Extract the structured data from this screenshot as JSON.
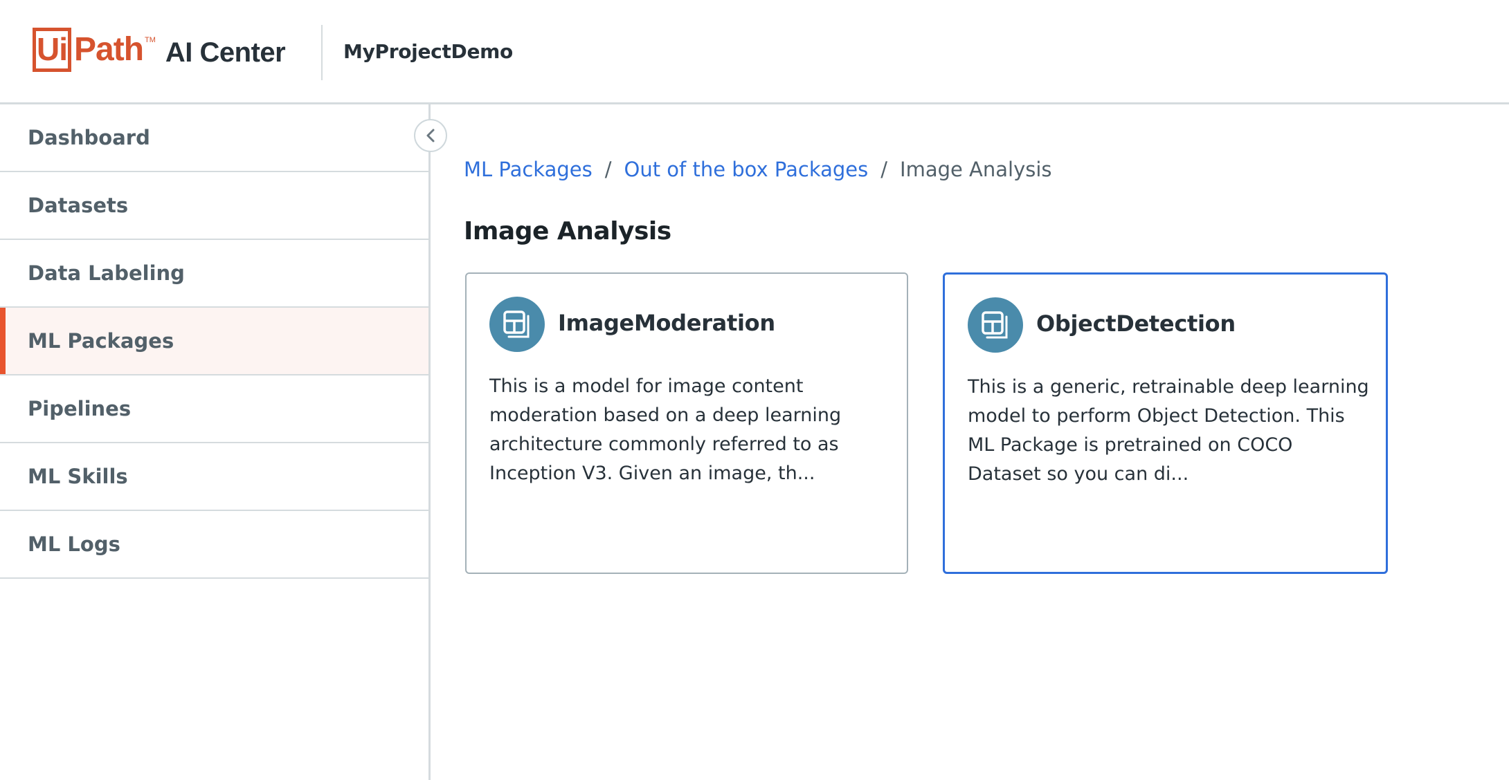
{
  "header": {
    "logo_brand": "Ui",
    "logo_brand_rest": "Path",
    "logo_tm": "TM",
    "product_name": "AI Center",
    "project_name": "MyProjectDemo"
  },
  "sidebar": {
    "items": [
      {
        "label": "Dashboard",
        "active": false
      },
      {
        "label": "Datasets",
        "active": false
      },
      {
        "label": "Data Labeling",
        "active": false
      },
      {
        "label": "ML Packages",
        "active": true
      },
      {
        "label": "Pipelines",
        "active": false
      },
      {
        "label": "ML Skills",
        "active": false
      },
      {
        "label": "ML Logs",
        "active": false
      }
    ],
    "collapse_icon": "chevron-left-icon"
  },
  "breadcrumb": {
    "items": [
      "ML Packages",
      "Out of the box Packages",
      "Image Analysis"
    ],
    "separator": "/"
  },
  "page": {
    "title": "Image Analysis"
  },
  "cards": [
    {
      "title": "ImageModeration",
      "icon": "package-icon",
      "description": "This is a model for image content moderation based on a deep learning architecture commonly referred to as Inception V3. Given an image, th...",
      "selected": false
    },
    {
      "title": "ObjectDetection",
      "icon": "package-icon",
      "description": "This is a generic, retrainable deep learning model to perform Object Detection. This ML Package is pretrained on COCO Dataset so you can di...",
      "selected": true
    }
  ],
  "colors": {
    "brand_orange": "#d6532e",
    "active_accent": "#e8542e",
    "link_blue": "#2f6fdb",
    "icon_teal": "#4a8bab",
    "active_bg": "#fdf4f2"
  }
}
